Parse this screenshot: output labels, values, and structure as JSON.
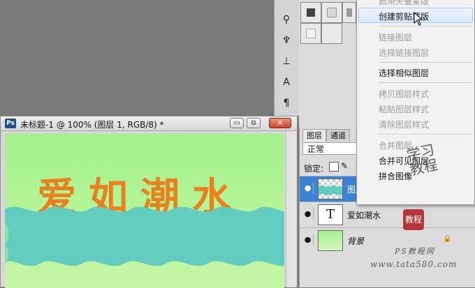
{
  "document": {
    "app_icon_text": "Ps",
    "title": "未标题-1 @ 100% (图层 1, RGB/8) *",
    "minimize_symbol": "▭",
    "restore_symbol": "⧉",
    "close_symbol": "×",
    "canvas_text": "爱如潮水",
    "colors": {
      "bg_top": "#a4f18b",
      "wave": "#62ccbe",
      "text": "#e9821c"
    }
  },
  "tools": {
    "icons": [
      "clone-stamp-icon",
      "history-brush-icon",
      "stamp-icon",
      "type-tool-icon",
      "paragraph-icon"
    ],
    "glyphs": [
      "⚲",
      "♆",
      "⊥",
      "A",
      "¶"
    ]
  },
  "layers_panel": {
    "tabs": [
      "图层",
      "通道"
    ],
    "blend_mode": "正常",
    "lock_label": "锁定:",
    "layers": [
      {
        "name": "图层 1",
        "selected": true,
        "thumb": "checker"
      },
      {
        "name": "爱如潮水",
        "selected": false,
        "thumb": "T"
      },
      {
        "name": "背景",
        "selected": false,
        "thumb": "green",
        "lock": "🔒"
      }
    ],
    "eye_symbol": "●"
  },
  "context_menu": {
    "items": [
      {
        "label": "启用矢量蒙版",
        "disabled": true
      },
      {
        "label": "创建剪贴蒙版",
        "disabled": false,
        "hover": true
      },
      {
        "label": "链接图层",
        "disabled": true
      },
      {
        "label": "选择链接图层",
        "disabled": true
      },
      {
        "label": "选择相似图层",
        "disabled": false
      },
      {
        "label": "拷贝图层样式",
        "disabled": true
      },
      {
        "label": "粘贴图层样式",
        "disabled": true
      },
      {
        "label": "清除图层样式",
        "disabled": true
      },
      {
        "label": "合并图层",
        "disabled": true
      },
      {
        "label": "合并可见图层",
        "disabled": false
      },
      {
        "label": "拼合图像",
        "disabled": false
      }
    ]
  },
  "watermark": {
    "title_top": "PS教程网",
    "url": "www.tata580.com",
    "stamp_text": "教程",
    "signature": "学习 教程"
  }
}
